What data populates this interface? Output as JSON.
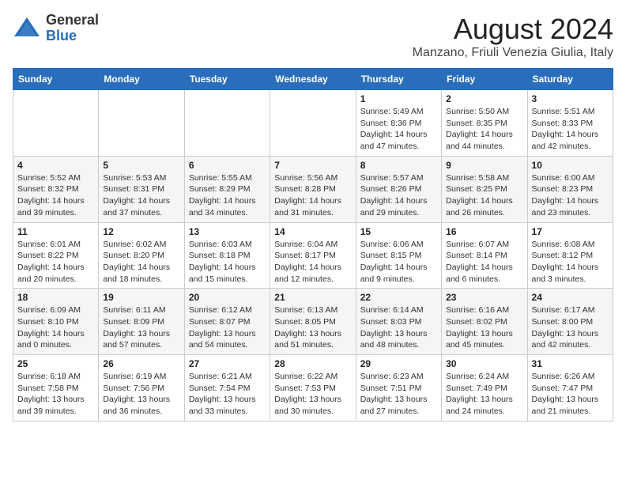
{
  "logo": {
    "general": "General",
    "blue": "Blue"
  },
  "title": "August 2024",
  "location": "Manzano, Friuli Venezia Giulia, Italy",
  "weekdays": [
    "Sunday",
    "Monday",
    "Tuesday",
    "Wednesday",
    "Thursday",
    "Friday",
    "Saturday"
  ],
  "weeks": [
    [
      {
        "day": "",
        "info": ""
      },
      {
        "day": "",
        "info": ""
      },
      {
        "day": "",
        "info": ""
      },
      {
        "day": "",
        "info": ""
      },
      {
        "day": "1",
        "info": "Sunrise: 5:49 AM\nSunset: 8:36 PM\nDaylight: 14 hours\nand 47 minutes."
      },
      {
        "day": "2",
        "info": "Sunrise: 5:50 AM\nSunset: 8:35 PM\nDaylight: 14 hours\nand 44 minutes."
      },
      {
        "day": "3",
        "info": "Sunrise: 5:51 AM\nSunset: 8:33 PM\nDaylight: 14 hours\nand 42 minutes."
      }
    ],
    [
      {
        "day": "4",
        "info": "Sunrise: 5:52 AM\nSunset: 8:32 PM\nDaylight: 14 hours\nand 39 minutes."
      },
      {
        "day": "5",
        "info": "Sunrise: 5:53 AM\nSunset: 8:31 PM\nDaylight: 14 hours\nand 37 minutes."
      },
      {
        "day": "6",
        "info": "Sunrise: 5:55 AM\nSunset: 8:29 PM\nDaylight: 14 hours\nand 34 minutes."
      },
      {
        "day": "7",
        "info": "Sunrise: 5:56 AM\nSunset: 8:28 PM\nDaylight: 14 hours\nand 31 minutes."
      },
      {
        "day": "8",
        "info": "Sunrise: 5:57 AM\nSunset: 8:26 PM\nDaylight: 14 hours\nand 29 minutes."
      },
      {
        "day": "9",
        "info": "Sunrise: 5:58 AM\nSunset: 8:25 PM\nDaylight: 14 hours\nand 26 minutes."
      },
      {
        "day": "10",
        "info": "Sunrise: 6:00 AM\nSunset: 8:23 PM\nDaylight: 14 hours\nand 23 minutes."
      }
    ],
    [
      {
        "day": "11",
        "info": "Sunrise: 6:01 AM\nSunset: 8:22 PM\nDaylight: 14 hours\nand 20 minutes."
      },
      {
        "day": "12",
        "info": "Sunrise: 6:02 AM\nSunset: 8:20 PM\nDaylight: 14 hours\nand 18 minutes."
      },
      {
        "day": "13",
        "info": "Sunrise: 6:03 AM\nSunset: 8:18 PM\nDaylight: 14 hours\nand 15 minutes."
      },
      {
        "day": "14",
        "info": "Sunrise: 6:04 AM\nSunset: 8:17 PM\nDaylight: 14 hours\nand 12 minutes."
      },
      {
        "day": "15",
        "info": "Sunrise: 6:06 AM\nSunset: 8:15 PM\nDaylight: 14 hours\nand 9 minutes."
      },
      {
        "day": "16",
        "info": "Sunrise: 6:07 AM\nSunset: 8:14 PM\nDaylight: 14 hours\nand 6 minutes."
      },
      {
        "day": "17",
        "info": "Sunrise: 6:08 AM\nSunset: 8:12 PM\nDaylight: 14 hours\nand 3 minutes."
      }
    ],
    [
      {
        "day": "18",
        "info": "Sunrise: 6:09 AM\nSunset: 8:10 PM\nDaylight: 14 hours\nand 0 minutes."
      },
      {
        "day": "19",
        "info": "Sunrise: 6:11 AM\nSunset: 8:09 PM\nDaylight: 13 hours\nand 57 minutes."
      },
      {
        "day": "20",
        "info": "Sunrise: 6:12 AM\nSunset: 8:07 PM\nDaylight: 13 hours\nand 54 minutes."
      },
      {
        "day": "21",
        "info": "Sunrise: 6:13 AM\nSunset: 8:05 PM\nDaylight: 13 hours\nand 51 minutes."
      },
      {
        "day": "22",
        "info": "Sunrise: 6:14 AM\nSunset: 8:03 PM\nDaylight: 13 hours\nand 48 minutes."
      },
      {
        "day": "23",
        "info": "Sunrise: 6:16 AM\nSunset: 8:02 PM\nDaylight: 13 hours\nand 45 minutes."
      },
      {
        "day": "24",
        "info": "Sunrise: 6:17 AM\nSunset: 8:00 PM\nDaylight: 13 hours\nand 42 minutes."
      }
    ],
    [
      {
        "day": "25",
        "info": "Sunrise: 6:18 AM\nSunset: 7:58 PM\nDaylight: 13 hours\nand 39 minutes."
      },
      {
        "day": "26",
        "info": "Sunrise: 6:19 AM\nSunset: 7:56 PM\nDaylight: 13 hours\nand 36 minutes."
      },
      {
        "day": "27",
        "info": "Sunrise: 6:21 AM\nSunset: 7:54 PM\nDaylight: 13 hours\nand 33 minutes."
      },
      {
        "day": "28",
        "info": "Sunrise: 6:22 AM\nSunset: 7:53 PM\nDaylight: 13 hours\nand 30 minutes."
      },
      {
        "day": "29",
        "info": "Sunrise: 6:23 AM\nSunset: 7:51 PM\nDaylight: 13 hours\nand 27 minutes."
      },
      {
        "day": "30",
        "info": "Sunrise: 6:24 AM\nSunset: 7:49 PM\nDaylight: 13 hours\nand 24 minutes."
      },
      {
        "day": "31",
        "info": "Sunrise: 6:26 AM\nSunset: 7:47 PM\nDaylight: 13 hours\nand 21 minutes."
      }
    ]
  ]
}
